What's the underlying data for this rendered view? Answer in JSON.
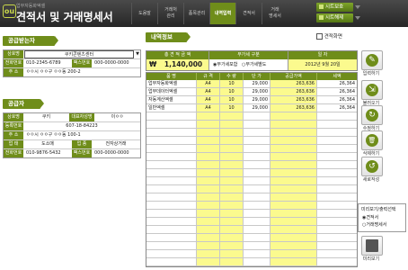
{
  "header": {
    "subtitle": "업무자동화엑셀",
    "title": "견적서 및 거래명세서",
    "logo": "ou",
    "tabs": [
      {
        "label": "도움말"
      },
      {
        "label": "거래처\n관리"
      },
      {
        "label": "품목관리"
      },
      {
        "label": "내역입력"
      },
      {
        "label": "견적서"
      },
      {
        "label": "거래\n명세서"
      }
    ],
    "sheet_show": "시트보호",
    "sheet_release": "시트해제"
  },
  "buyer": {
    "section": "공급받는자",
    "rows": [
      {
        "label": "상호명",
        "value": "쿠키콘텐츠센터"
      },
      {
        "label": "전화번호",
        "value": "010-2345-6789",
        "label2": "팩스번호",
        "value2": "000-0000-0000"
      },
      {
        "label": "주 소",
        "value": "ㅇㅇ시 ㅇㅇ구 ㅇㅇ동 200-2"
      }
    ]
  },
  "supplier": {
    "section": "공급자",
    "rows": [
      {
        "label": "상호명",
        "value": "쿠키",
        "label2": "대표자성명",
        "value2": "이ㅇㅇ"
      },
      {
        "label": "등록번호",
        "value": "607-18-84223"
      },
      {
        "label": "주 소",
        "value": "ㅇㅇ시 ㅇㅇ구 ㅇㅇ동 100-1"
      },
      {
        "label": "업 태",
        "value": "도소매",
        "label2": "업 종",
        "value2": "전자상거래"
      },
      {
        "label": "전화번호",
        "value": "010-9876-5432",
        "label2": "팩스번호",
        "value2": "000-0000-0000"
      }
    ]
  },
  "details": {
    "section": "내역정보",
    "print_check": "견적화면",
    "total_label": "총 견 적 금 액",
    "currency": "₩",
    "total": "1,140,000",
    "vat_label": "부가세 구분",
    "vat_opt1": "부가세포함",
    "vat_opt2": "부가세별도",
    "date_label": "일 자",
    "date": "2012년 9월 20일",
    "columns": [
      "품 명",
      "규 격",
      "수 량",
      "단 가",
      "공급가액",
      "세액"
    ],
    "rows": [
      [
        "업무자동화엑셀",
        "A4",
        "10",
        "29,000",
        "263,636",
        "26,364"
      ],
      [
        "업무데이터엑셀",
        "A4",
        "10",
        "29,000",
        "263,636",
        "26,364"
      ],
      [
        "자동계산엑셀",
        "A4",
        "10",
        "29,000",
        "263,636",
        "26,364"
      ],
      [
        "일반엑셀",
        "A4",
        "10",
        "29,000",
        "263,636",
        "26,364"
      ]
    ]
  },
  "sidebar": {
    "buttons": [
      {
        "label": "입력하기",
        "icon": "✎"
      },
      {
        "label": "불러오기",
        "icon": "⇲"
      },
      {
        "label": "수정하기",
        "icon": "↻"
      },
      {
        "label": "삭제하기",
        "icon": "🗑"
      },
      {
        "label": "새로작성",
        "icon": "↺"
      }
    ],
    "preview_title": "미리보기/출력선택",
    "preview_opt1": "견적서",
    "preview_opt2": "거래명세서",
    "preview_button": "미리보기"
  },
  "colors": {
    "accent": "#6f8d1a",
    "yellow": "#fbfa8e",
    "header": "#333333"
  }
}
